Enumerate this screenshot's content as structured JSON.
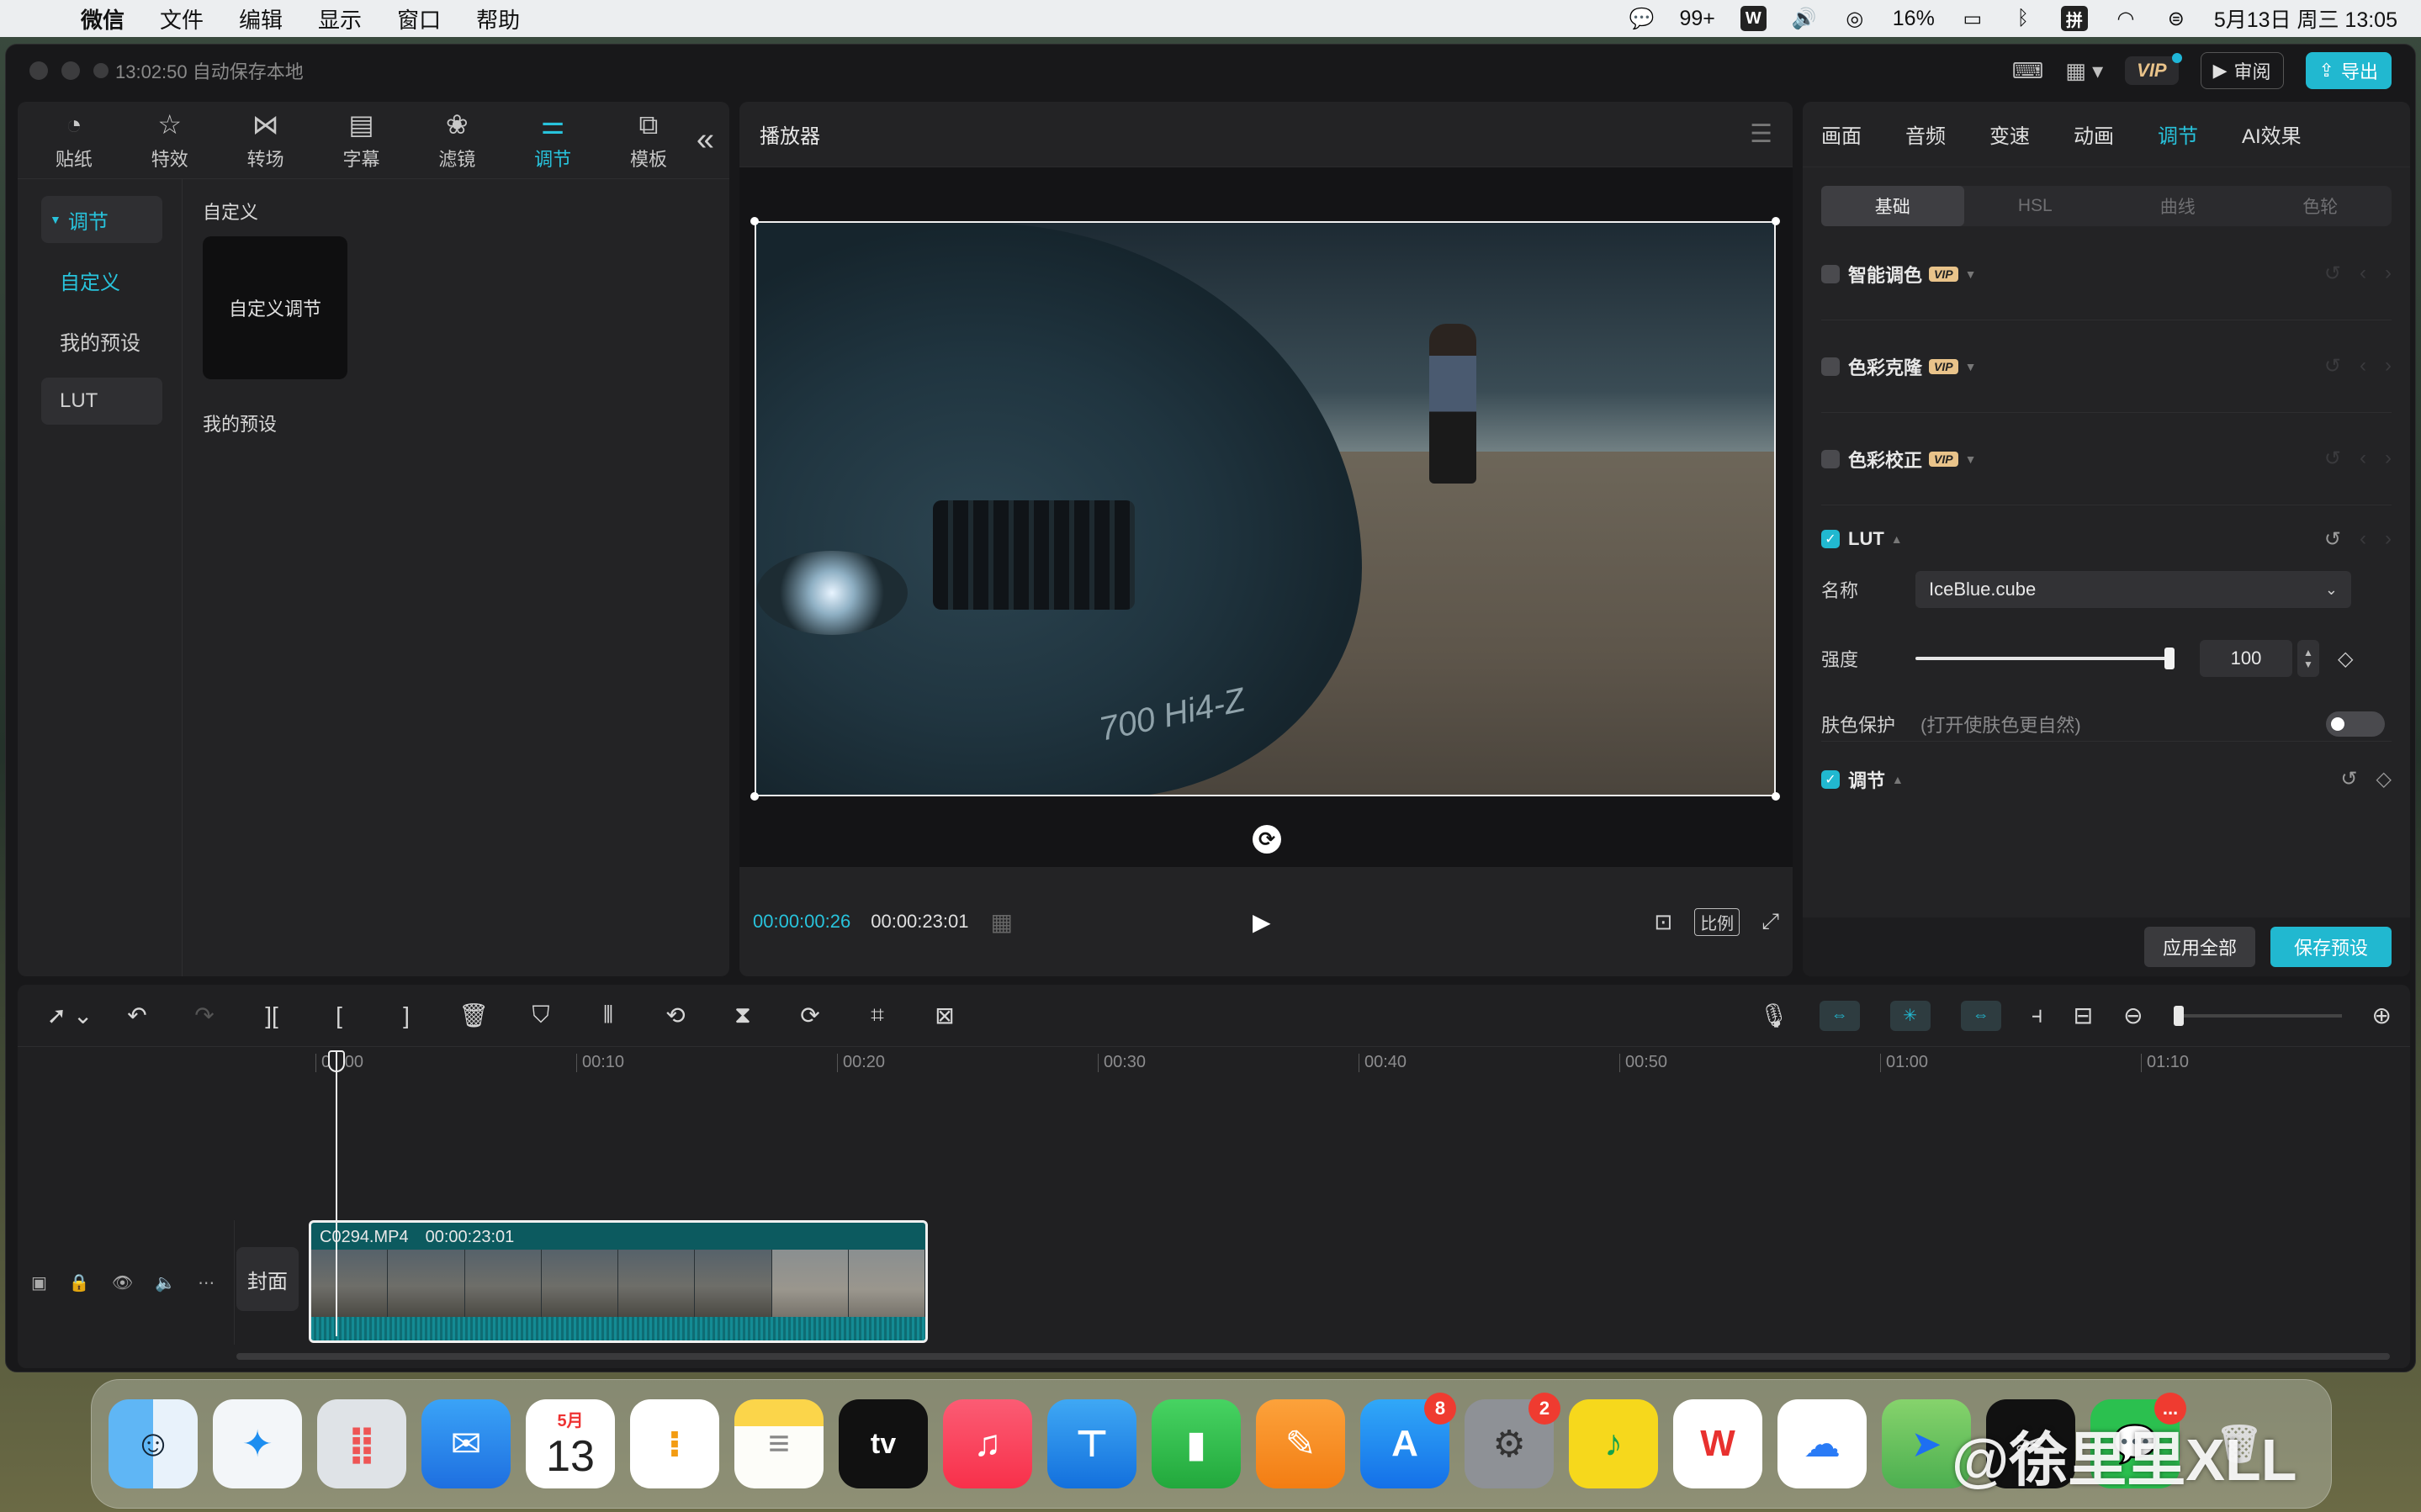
{
  "menubar": {
    "app_name": "微信",
    "menus": [
      "文件",
      "编辑",
      "显示",
      "窗口",
      "帮助"
    ],
    "wechat_count": "99+",
    "battery": "16%",
    "input_method": "拼",
    "datetime": "5月13日 周三  13:05"
  },
  "window": {
    "autosave_text": "13:02:50 自动保存本地",
    "vip_label": "VIP",
    "review_label": "审阅",
    "export_label": "导出"
  },
  "left_panel": {
    "tabs": [
      {
        "label": "贴纸",
        "icon": "sticker-icon"
      },
      {
        "label": "特效",
        "icon": "effects-icon"
      },
      {
        "label": "转场",
        "icon": "transition-icon"
      },
      {
        "label": "字幕",
        "icon": "subtitle-icon"
      },
      {
        "label": "滤镜",
        "icon": "filter-icon"
      },
      {
        "label": "调节",
        "icon": "adjust-icon",
        "active": true
      },
      {
        "label": "模板",
        "icon": "template-icon"
      }
    ],
    "nav": {
      "header": "调节",
      "items": [
        "自定义",
        "我的预设",
        "LUT"
      ]
    },
    "section_custom": "自定义",
    "custom_card": "自定义调节",
    "section_presets": "我的预设"
  },
  "player": {
    "title": "播放器",
    "plate_text": "700 Hi4-Z",
    "timecode_current": "00:00:00:26",
    "timecode_total": "00:00:23:01",
    "ratio_label": "比例"
  },
  "right_panel": {
    "tabs": [
      "画面",
      "音频",
      "变速",
      "动画",
      "调节",
      "AI效果"
    ],
    "active_tab": "调节",
    "subtabs": [
      "基础",
      "HSL",
      "曲线",
      "色轮"
    ],
    "rows": {
      "smart_color": "智能调色",
      "color_clone": "色彩克隆",
      "color_correct": "色彩校正",
      "lut": "LUT",
      "adjust": "调节"
    },
    "vip_tag": "VIP",
    "name_label": "名称",
    "name_value": "IceBlue.cube",
    "strength_label": "强度",
    "strength_value": "100",
    "strength_level": 1.0,
    "skin_label": "肤色保护",
    "skin_hint": "(打开使肤色更自然)",
    "apply_all": "应用全部",
    "save_preset": "保存预设"
  },
  "timeline": {
    "ruler": [
      "00:00",
      "00:10",
      "00:20",
      "00:30",
      "00:40",
      "00:50",
      "01:00",
      "01:10"
    ],
    "cover_label": "封面",
    "clip_name": "C0294.MP4",
    "clip_duration": "00:00:23:01"
  },
  "dock": {
    "calendar_month": "5月",
    "calendar_day": "13",
    "appstore_badge": "8",
    "settings_badge": "2",
    "wechat_badge": "...",
    "watermark": "@徐里里XLL"
  },
  "colors": {
    "accent": "#21b8d0",
    "panel": "#232325",
    "window": "#18181a"
  }
}
